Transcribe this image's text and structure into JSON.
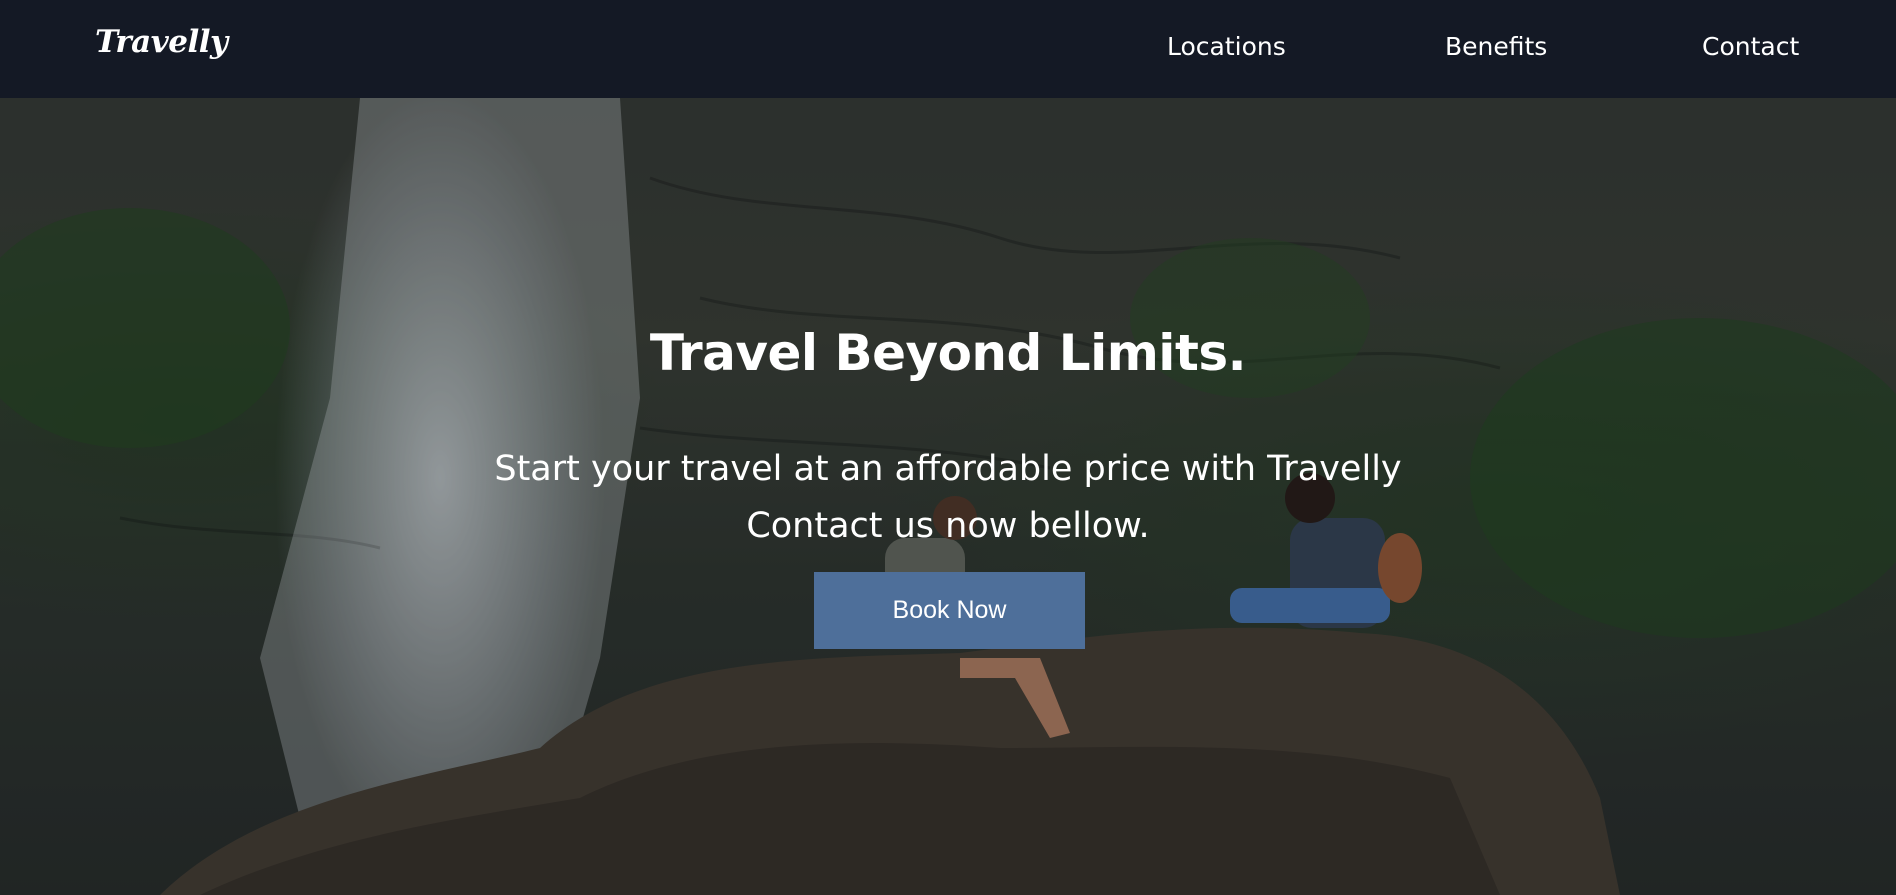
{
  "header": {
    "logo": "Travelly",
    "nav": [
      {
        "label": "Locations"
      },
      {
        "label": "Benefits"
      },
      {
        "label": "Contact"
      }
    ]
  },
  "hero": {
    "title": "Travel Beyond Limits.",
    "subtitle_line1": "Start your travel at an affordable price with Travelly",
    "subtitle_line2": "Contact us now bellow.",
    "cta_label": "Book Now",
    "image": "waterfall-hikers-photo"
  },
  "colors": {
    "nav_bg": "#141925",
    "cta_bg": "#4e6f9a",
    "text": "#ffffff"
  }
}
